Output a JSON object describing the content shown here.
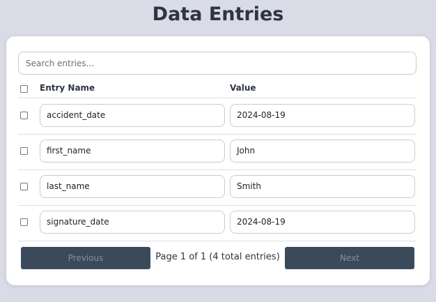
{
  "page": {
    "title": "Data Entries"
  },
  "search": {
    "placeholder": "Search entries..."
  },
  "table": {
    "columns": {
      "name": "Entry Name",
      "value": "Value"
    },
    "rows": [
      {
        "name": "accident_date",
        "value": "2024-08-19"
      },
      {
        "name": "first_name",
        "value": "John"
      },
      {
        "name": "last_name",
        "value": "Smith"
      },
      {
        "name": "signature_date",
        "value": "2024-08-19"
      }
    ]
  },
  "pagination": {
    "previous_label": "Previous",
    "next_label": "Next",
    "info": "Page 1 of 1 (4 total entries)"
  },
  "colors": {
    "background": "#d9dbe7",
    "card": "#ffffff",
    "button": "#3a4a5a",
    "button_text_disabled": "#8391a0",
    "heading": "#2c3540"
  }
}
